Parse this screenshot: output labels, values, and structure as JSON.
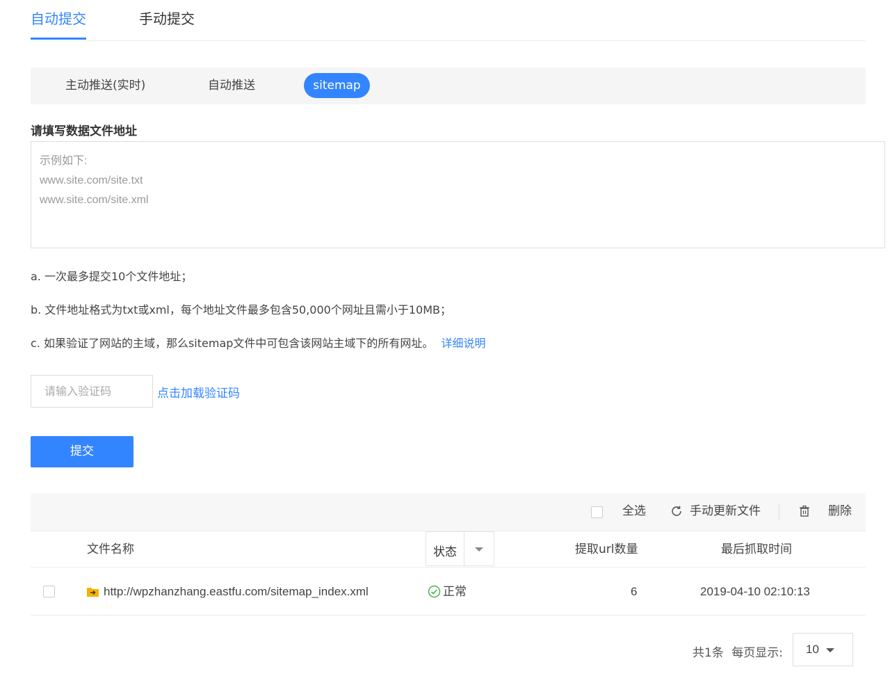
{
  "tabs": [
    {
      "label": "自动提交",
      "active": true
    },
    {
      "label": "手动提交",
      "active": false
    }
  ],
  "subtabs": [
    {
      "label": "主动推送(实时)"
    },
    {
      "label": "自动推送"
    },
    {
      "label": "sitemap",
      "active": true
    }
  ],
  "form": {
    "label": "请填写数据文件地址",
    "url_placeholder_lines": [
      "示例如下:",
      "www.site.com/site.txt",
      "www.site.com/site.xml"
    ],
    "notes": {
      "a": "a. 一次最多提交10个文件地址；",
      "b": "b. 文件地址格式为txt或xml，每个地址文件最多包含50,000个网址且需小于10MB；",
      "c": "c. 如果验证了网站的主域，那么sitemap文件中可包含该网站主域下的所有网址。",
      "c_link": "详细说明"
    },
    "captcha_placeholder": "请输入验证码",
    "captcha_link": "点击加载验证码",
    "submit_label": "提交"
  },
  "toolbar": {
    "select_all": "全选",
    "refresh": "手动更新文件",
    "delete": "删除"
  },
  "table": {
    "columns": {
      "name": "文件名称",
      "status": "状态",
      "url_count": "提取url数量",
      "last_fetch": "最后抓取时间"
    },
    "rows": [
      {
        "file": "http://wpzhanzhang.eastfu.com/sitemap_index.xml",
        "status": "正常",
        "url_count": "6",
        "last_fetch": "2019-04-10 02:10:13"
      }
    ]
  },
  "pagination": {
    "total": "共1条",
    "per_page_label": "每页显示:",
    "per_page": "10"
  },
  "colors": {
    "accent": "#3385ff",
    "ok": "#4caf50",
    "folder": "#f5b301"
  }
}
